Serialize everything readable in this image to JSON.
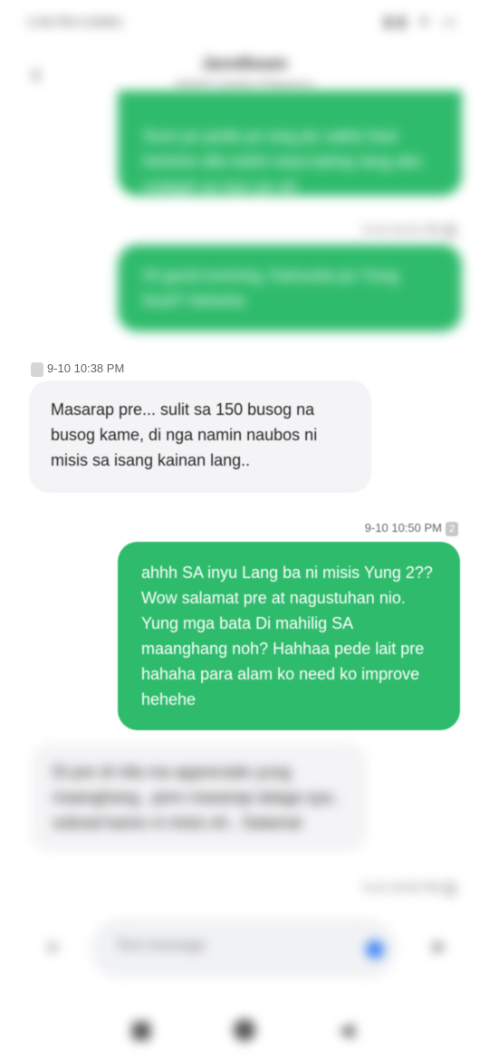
{
  "status_bar": {
    "time": "2:49 PM 0.0KB/s",
    "icons": "▮▮ ▾ ▭"
  },
  "header": {
    "back_icon": "chevron-left-icon",
    "contact_name": "Jaredbeam",
    "contact_sub": "SMART Mobile Philippines"
  },
  "messages": [
    {
      "dir": "out",
      "text": "Sure po pede po ang pic sakto kasi hehehe dito kahit nasa bahay lang ako malapit sa inyo po eh",
      "blurred": true
    },
    {
      "dir": "out",
      "meta": "9-10 10:31 PM",
      "text": "Hi good evening, Kamusta po Yung food? Hehehe",
      "blurred": true
    },
    {
      "dir": "in",
      "meta": "9-10 10:38 PM",
      "text": "Masarap pre... sulit sa 150  busog na busog kame, di nga namin naubos ni misis sa isang kainan lang..",
      "blurred": false
    },
    {
      "dir": "out",
      "meta": "9-10 10:50 PM",
      "sim": "2",
      "text": "ahhh SA inyu Lang ba ni misis Yung 2?? Wow salamat pre at nagustuhan nio. Yung mga bata Di mahilig SA maanghang noh? Hahhaa pede lait pre hahaha para alam ko need ko improve hehehe",
      "blurred": false
    },
    {
      "dir": "in",
      "text": "Di pre di nila ma appreciate yung maanghang.. pero masarap talaga sya.. sobrad kame ni misis eh.. Salamat",
      "blurred": true
    },
    {
      "dir": "out",
      "meta": "9-10 10:55 PM",
      "blurred": true
    }
  ],
  "composer": {
    "placeholder": "Text message",
    "plus_icon": "plus-icon",
    "send_icon": "send-icon"
  },
  "nav": {
    "recents": "recents-icon",
    "home": "home-icon",
    "back": "back-icon"
  },
  "colors": {
    "outgoing": "#2fbb6c",
    "incoming": "#f4f4f6"
  }
}
